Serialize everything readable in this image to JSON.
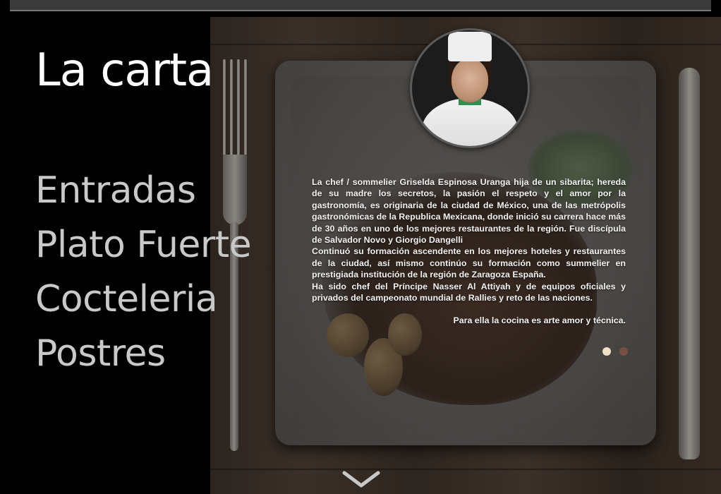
{
  "page": {
    "title": "La carta"
  },
  "menu": {
    "items": [
      "Entradas",
      "Plato Fuerte",
      "Cocteleria",
      "Postres"
    ]
  },
  "chef": {
    "bio": [
      "La chef / sommelier  Griselda Espinosa Uranga hija de un sibarita; hereda de su madre los secretos, la pasión el respeto y el amor por la gastronomía, es originaria de la ciudad de México, una de las metrópolis gastronómicas de la Republica Mexicana, donde inició su carrera hace más de 30 años en uno de los mejores restaurantes de la región. Fue discípula de Salvador Novo y Giorgio Dangelli",
      "Continuó su formación ascendente en los mejores hoteles y restaurantes de la ciudad, así mismo continúo su formación como summelier en prestigiada institución de la región de Zaragoza España.",
      "Ha sido chef del Príncipe Nasser Al Attiyah y de equipos oficiales y privados del campeonato mundial de Rallies y reto de las naciones."
    ],
    "closing": "Para ella la cocina es arte amor y técnica."
  },
  "slider": {
    "total": 2,
    "active": 1,
    "colors": {
      "active": "#f0e0c4",
      "inactive": "#7a4f43"
    }
  },
  "icons": {
    "scroll": "chevron-down-icon"
  }
}
